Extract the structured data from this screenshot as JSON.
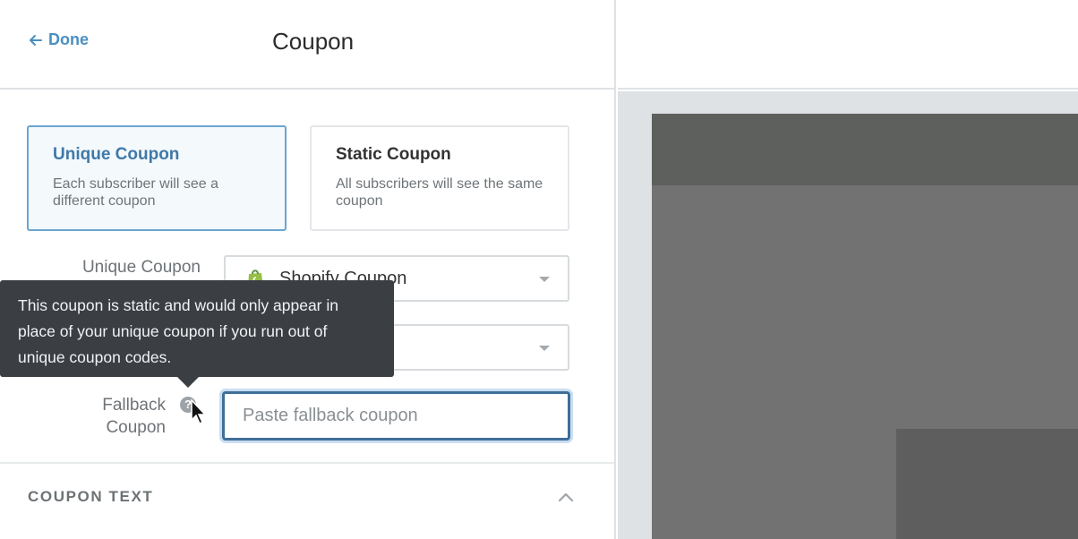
{
  "header": {
    "done_label": "Done",
    "title": "Coupon"
  },
  "coupon_type": {
    "options": [
      {
        "title": "Unique Coupon",
        "description": "Each subscriber will see a different coupon",
        "selected": true
      },
      {
        "title": "Static Coupon",
        "description": "All subscribers will see the same coupon",
        "selected": false
      }
    ]
  },
  "unique_coupon": {
    "label": "Unique Coupon",
    "value": "Shopify Coupon",
    "icon": "shopify-bag-icon"
  },
  "second_dropdown": {
    "value": ""
  },
  "fallback": {
    "label_line1": "Fallback",
    "label_line2": "Coupon",
    "placeholder": "Paste fallback coupon",
    "help_icon": "question-circle-icon"
  },
  "tooltip": {
    "text": "This coupon is static and would only appear in place of your unique coupon if you run out of unique coupon codes."
  },
  "sections": {
    "coupon_text_title": "COUPON TEXT"
  },
  "colors": {
    "accent": "#4a8fc1",
    "selected_border": "#6aa5cf",
    "tooltip_bg": "#3b3f44",
    "input_focus": "#3f6e99"
  }
}
